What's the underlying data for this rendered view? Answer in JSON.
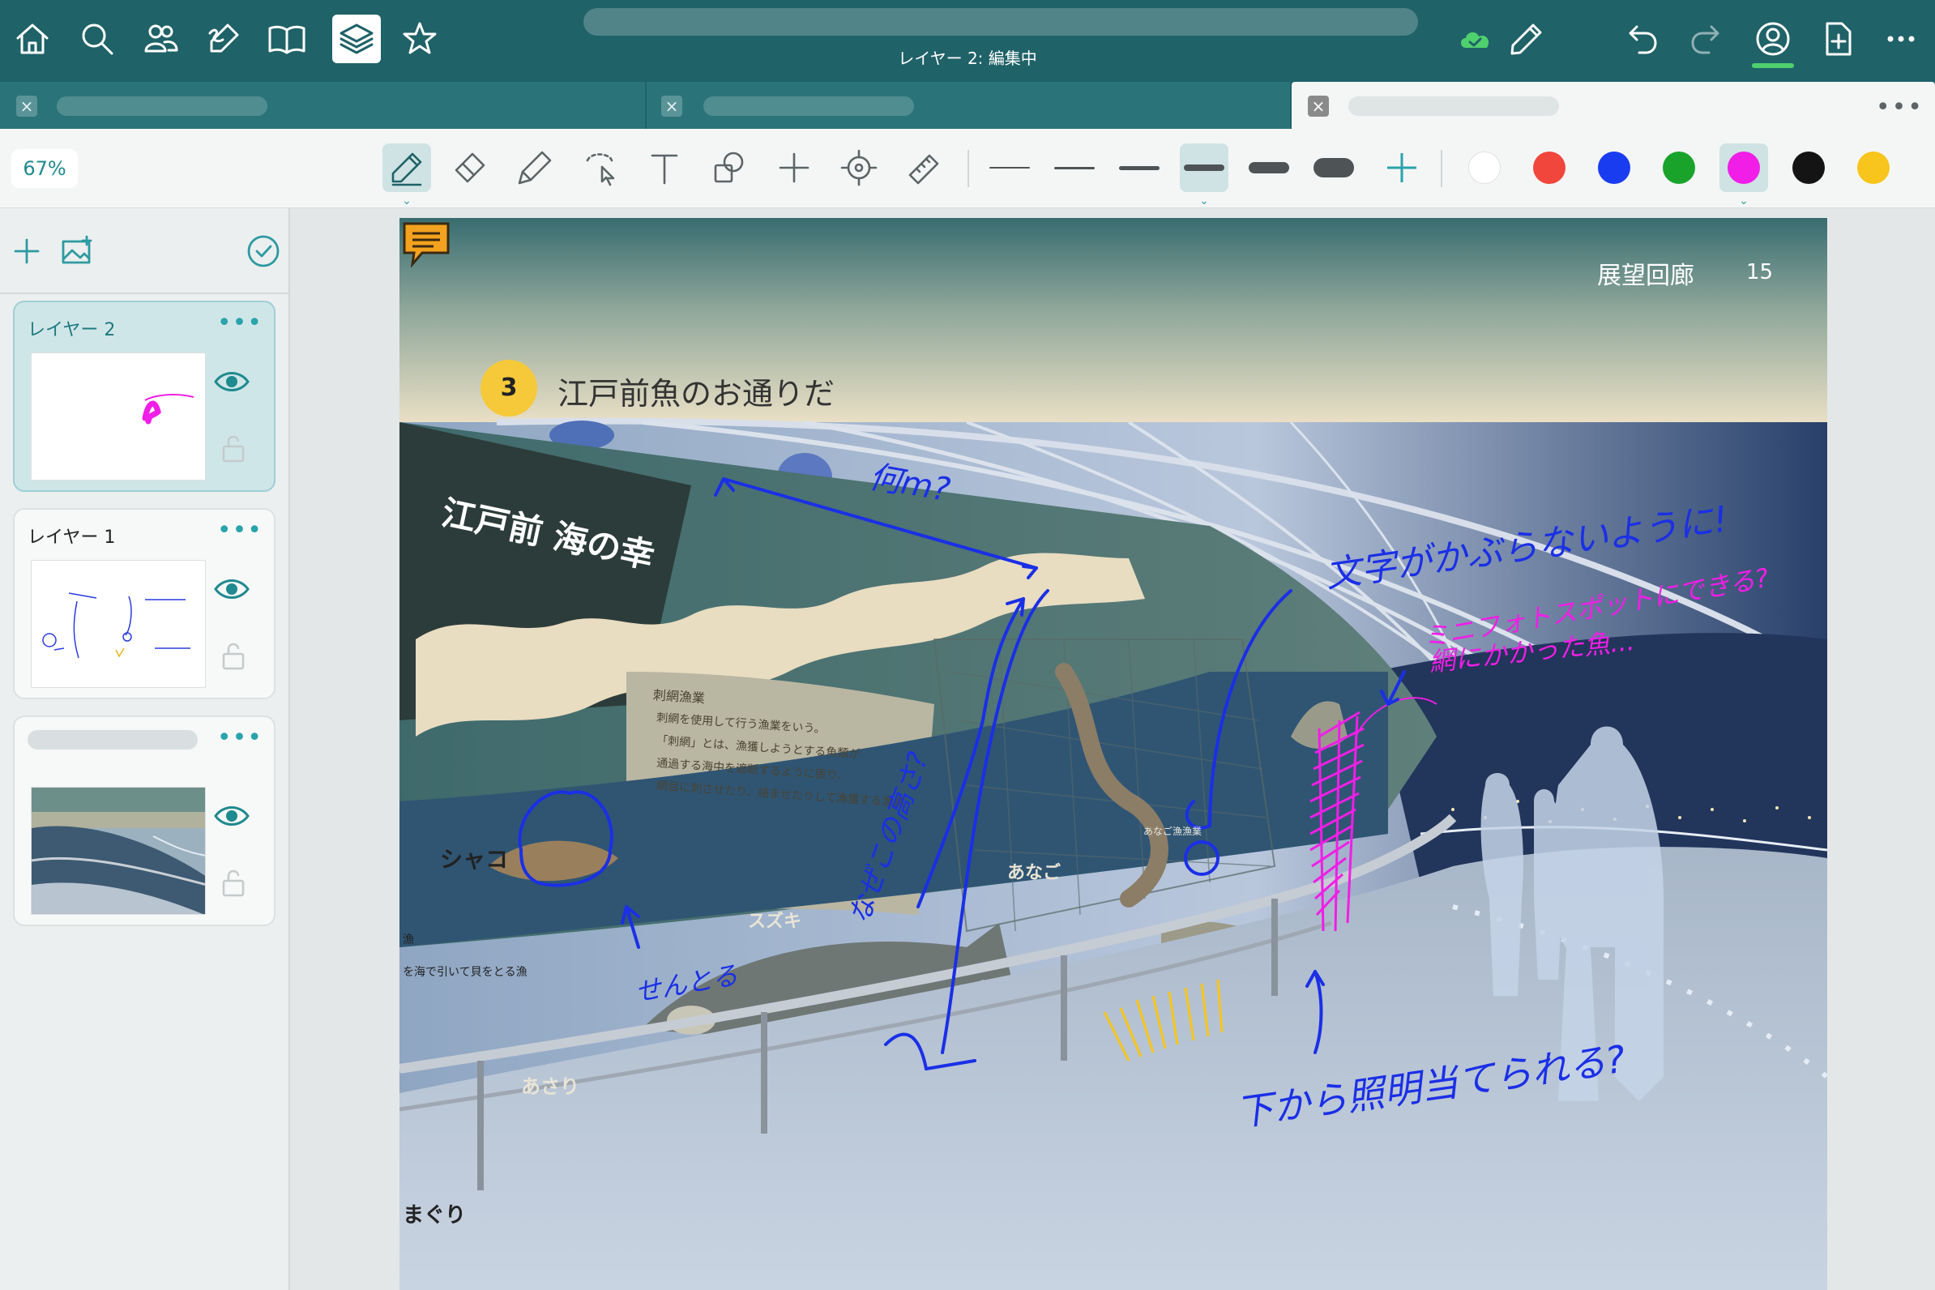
{
  "nav": {
    "icons": [
      "home-icon",
      "search-icon",
      "people-icon",
      "handwriting-icon",
      "book-icon",
      "layers-icon",
      "star-icon"
    ],
    "document_title": "",
    "edit_status": "レイヤー 2: 編集中",
    "right_icons": [
      "cloud-sync-icon",
      "pencil-icon",
      "undo-icon",
      "redo-icon",
      "profile-icon",
      "export-icon",
      "more-icon"
    ]
  },
  "tabs": [
    {
      "title": "",
      "active": false
    },
    {
      "title": "",
      "active": false
    },
    {
      "title": "",
      "active": true
    }
  ],
  "tab_more": "•••",
  "toolbar": {
    "zoom": "67%",
    "tools": [
      "pen-tool-icon",
      "eraser-tool-icon",
      "highlighter-tool-icon",
      "lasso-tool-icon",
      "text-tool-icon",
      "shape-tool-icon",
      "plus-tool-icon",
      "laser-pointer-icon",
      "ruler-tool-icon"
    ],
    "selected_tool": "pen-tool-icon",
    "stroke_widths": [
      "hairline",
      "thin",
      "medium",
      "regular",
      "thick",
      "extra-thick"
    ],
    "selected_stroke": "regular",
    "colors": [
      "#ffffff",
      "#f0463c",
      "#1a3cf0",
      "#1aa32b",
      "#f01ee6",
      "#141414",
      "#f7c51b"
    ],
    "selected_color": "#f01ee6"
  },
  "layers_panel": {
    "toolbar_icons": [
      "add-layer-icon",
      "add-image-layer-icon",
      "select-layers-icon"
    ],
    "layers": [
      {
        "name": "レイヤー 2",
        "active": true,
        "visible": true,
        "locked": false,
        "more": "•••"
      },
      {
        "name": "レイヤー 1",
        "active": false,
        "visible": true,
        "locked": false,
        "more": "•••"
      },
      {
        "name": "",
        "active": false,
        "visible": true,
        "locked": false,
        "more": "•••"
      }
    ]
  },
  "page": {
    "header_text": "展望回廊",
    "page_number": "15",
    "section_number": "3",
    "section_title": "江戸前魚のお通りだ",
    "photo_labels": {
      "edo_title": "江戸前 海の幸",
      "shako": "シャコ",
      "anago": "あなご",
      "suzuki": "スズキ",
      "asari": "あさり",
      "hamaguri": "まぐり",
      "fishing_head": "刺網漁業",
      "fishing_lines": [
        "刺網を使用して行う漁業をいう。",
        "「刺網」とは、漁獲しようとする魚類が",
        "通過する海中を遮断するように張り、",
        "網目に刺させたり、絡ませたりして漁獲する漁具"
      ],
      "anago_head": "あなご漁漁業",
      "side_note": "を海で引いて貝をとる漁",
      "side_shako_note": "漁"
    },
    "annotations": {
      "what_m": "何m?",
      "height_question": "なぜこの高さ?",
      "not_overlap": "文字がかぶらないように!",
      "photospot": "ミニフォトスポットにできる?",
      "net_fish": "網にかかった魚...",
      "delete": "せんとる",
      "lighting": "下から照明当てられる?"
    }
  },
  "comment_icon": "comment-icon"
}
